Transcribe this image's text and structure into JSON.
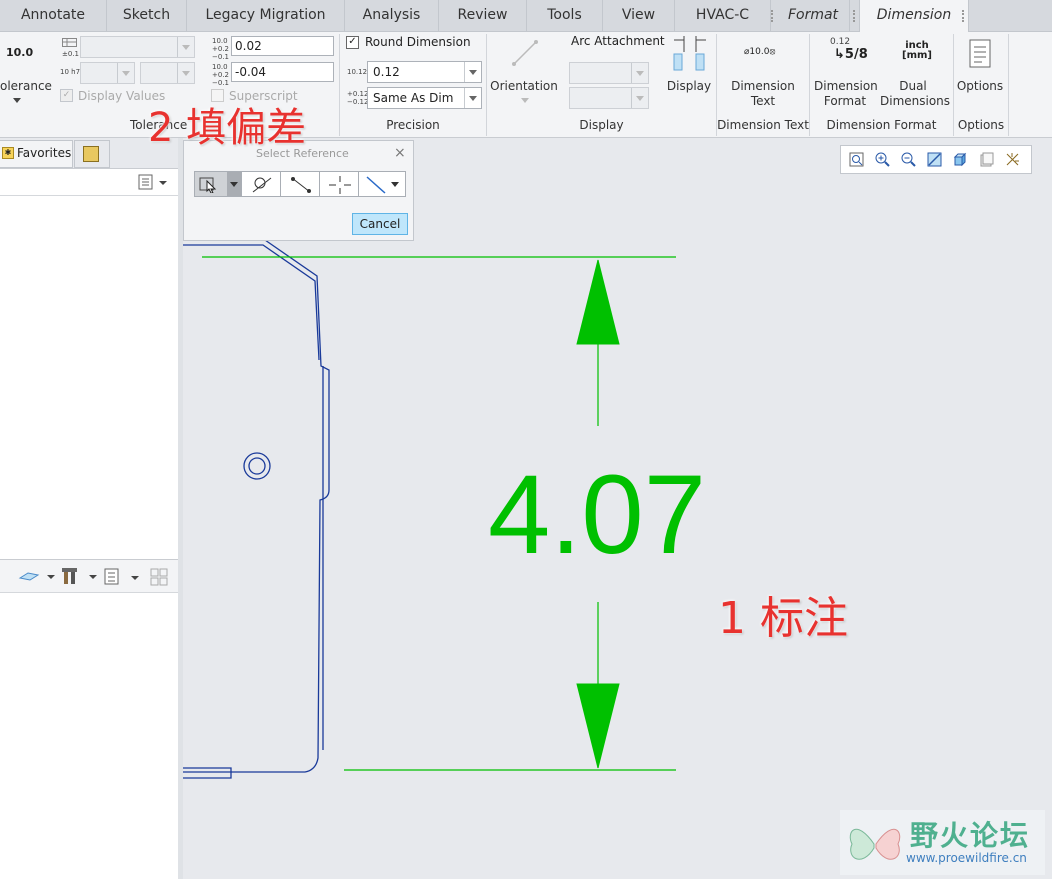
{
  "tabs": [
    {
      "label": "Annotate"
    },
    {
      "label": "Sketch"
    },
    {
      "label": "Legacy Migration"
    },
    {
      "label": "Analysis"
    },
    {
      "label": "Review"
    },
    {
      "label": "Tools"
    },
    {
      "label": "View"
    },
    {
      "label": "HVAC-C"
    },
    {
      "label": "Format"
    },
    {
      "label": "Dimension"
    }
  ],
  "ribbon": {
    "tolerance": {
      "icon_text": "10.0",
      "button_label": "olerance",
      "display_values_label": "Display Values",
      "group_label": "Tolerance",
      "upper_icon": "10.0 +0.2 −0.1",
      "upper_value": "0.02",
      "lower_icon": "10.0 +0.2 −0.1",
      "lower_value": "-0.04",
      "superscript_label": "Superscript",
      "fit_icon_1": "±0.1",
      "fit_icon_2": "10 h7"
    },
    "precision": {
      "round_label": "Round Dimension",
      "round_checked": true,
      "value_icon": "10.123",
      "value": "0.12",
      "tol_icon": "+0.123 −0.123",
      "tol_value": "Same As Dim",
      "group_label": "Precision"
    },
    "display": {
      "orientation_label": "Orientation",
      "arc_label": "Arc Attachment",
      "display_label": "Display",
      "group_label": "Display"
    },
    "dimension_text": {
      "icon_text": "⌀10.0⦻",
      "button_label": "Dimension Text",
      "group_label": "Dimension Text"
    },
    "dimension_format": {
      "icon_top": "0.12",
      "icon_fraction": "5/8",
      "format_label": "Dimension Format",
      "dual_icon_top": "inch",
      "dual_icon_bottom": "[mm]",
      "dual_label": "Dual Dimensions",
      "group_label": "Dimension Format"
    },
    "options": {
      "button_label": "Options",
      "group_label": "Options"
    }
  },
  "left_panel": {
    "favorites_tab": "Favorites"
  },
  "select_dialog": {
    "title": "Select Reference",
    "cancel_label": "Cancel"
  },
  "drawing": {
    "dimension_value": "4.07",
    "dimension_color": "#00c000",
    "geometry_color": "#1a3a9a"
  },
  "annotations": {
    "first": "1 标注",
    "second": "2 填偏差",
    "color": "#e8322f"
  },
  "watermark": {
    "title": "野火论坛",
    "url": "www.proewildfire.cn"
  }
}
